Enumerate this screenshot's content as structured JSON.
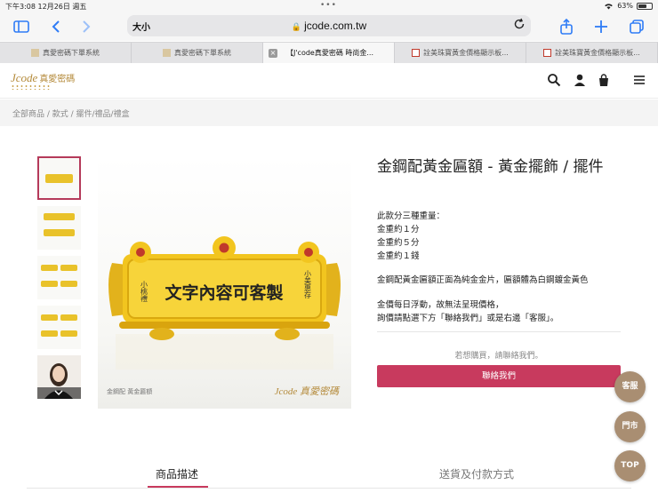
{
  "status_bar": {
    "time": "下午3:08",
    "date": "12月26日 週五",
    "battery": "63%",
    "battery_level": 0.63
  },
  "browser": {
    "text_size_label": "大小",
    "url": "jcode.com.tw",
    "tabs": [
      {
        "label": "真愛密碼下單系統",
        "active": false,
        "favicon": "gold"
      },
      {
        "label": "真愛密碼下單系統",
        "active": false,
        "favicon": "gold"
      },
      {
        "label": "【J'code真愛密碼 時尚金...",
        "active": true,
        "favicon": "close"
      },
      {
        "label": "詮美珠寶黃金價格顯示板...",
        "active": false,
        "favicon": "red"
      },
      {
        "label": "詮美珠寶黃金價格顯示板...",
        "active": false,
        "favicon": "red"
      }
    ]
  },
  "site": {
    "logo_text": "Jcode",
    "logo_cn": "真愛密碼",
    "breadcrumb": "全部商品 / 款式 / 擺件/禮品/禮盒"
  },
  "product": {
    "title": "金鋼配黃金匾額 - 黃金擺飾 / 擺件",
    "weight_intro": "此款分三種重量：",
    "weights": [
      "金重約１分",
      "金重約５分",
      "金重約１錢"
    ],
    "description": "金鋼配黃金匾額正面為純金金片，匾額體為白鋼鍍金黃色",
    "price_note_1": "金價每日浮動，故無法呈現價格，",
    "price_note_2": "詢價請點選下方「聯絡我們」或是右邊「客服」。",
    "buy_hint": "若想購買，請聯絡我們。",
    "contact_button": "聯絡我們",
    "image": {
      "plaque_text": "文字內容可客製",
      "left_small": "小桃禮",
      "right_small": "小美惠存",
      "caption": "金鋼配 黃金匾額",
      "watermark": "Jcode 真愛密碼"
    },
    "thumbnails": [
      {
        "label": "thumb-1"
      },
      {
        "label": "thumb-2"
      },
      {
        "label": "thumb-3"
      },
      {
        "label": "thumb-4"
      },
      {
        "label": "thumb-5"
      }
    ]
  },
  "floating": {
    "service": "客服",
    "store": "門市",
    "top": "TOP"
  },
  "page_tabs": {
    "description": "商品描述",
    "shipping": "送貨及付款方式"
  },
  "colors": {
    "accent": "#c83a5e",
    "gold": "#e9c22a",
    "float": "#a98e72",
    "brand": "#b48a3a"
  }
}
